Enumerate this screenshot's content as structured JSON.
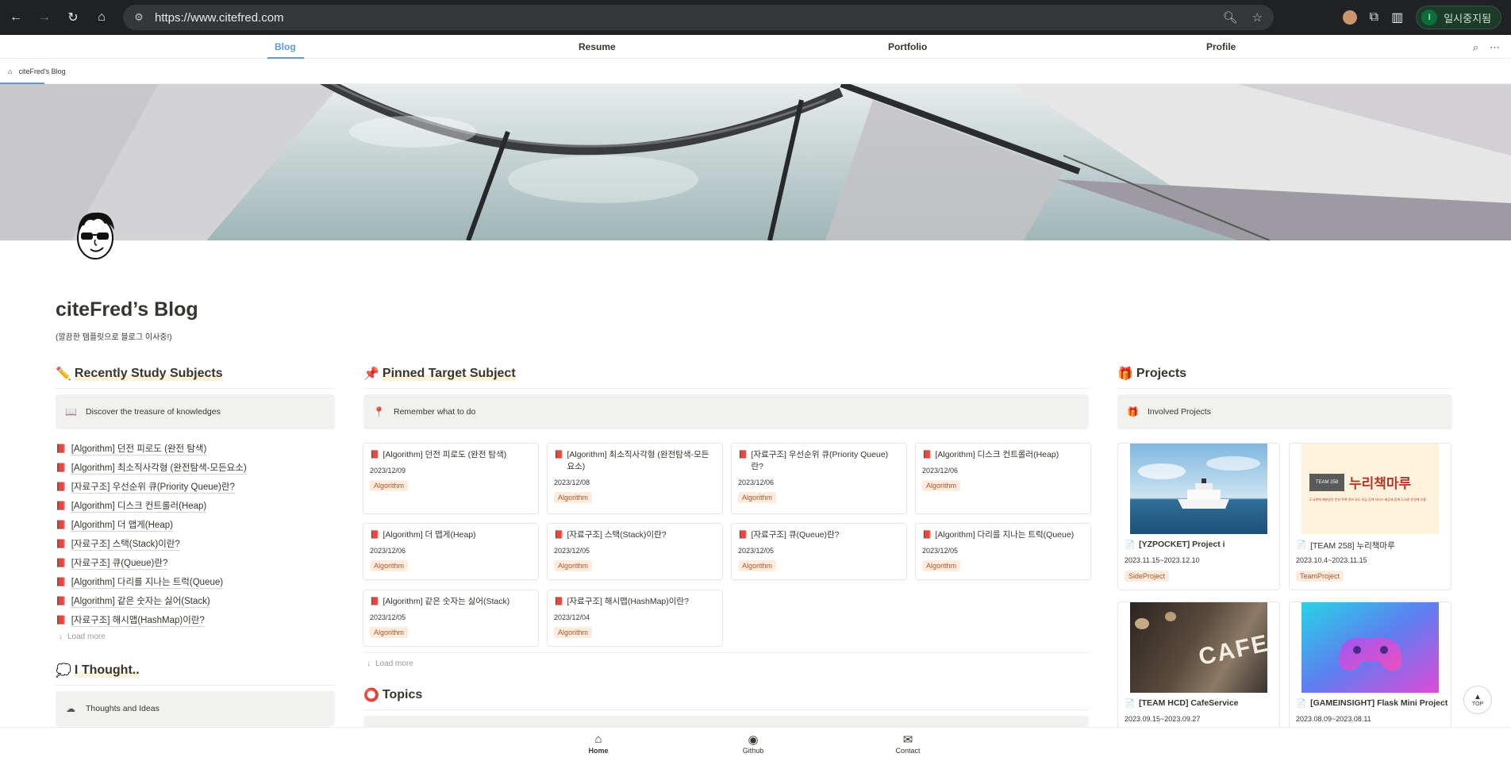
{
  "browser": {
    "url": "https://www.citefred.com",
    "profile_label": "일시중지됨",
    "profile_initial": "I"
  },
  "site_nav": {
    "items": [
      "Blog",
      "Resume",
      "Portfolio",
      "Profile"
    ],
    "active": "Blog"
  },
  "breadcrumb": "citeFred's Blog",
  "page": {
    "title": "citeFred’s Blog",
    "subtitle": "(깔끔한 템플릿으로 블로그 이사중!)"
  },
  "recent": {
    "heading": "Recently Study Subjects",
    "callout": "Discover the treasure of knowledges",
    "items": [
      "[Algorithm] 던전 피로도 (완전 탐색)",
      "[Algorithm] 최소직사각형 (완전탐색-모든요소)",
      "[자료구조] 우선순위 큐(Priority Queue)란?",
      "[Algorithm] 디스크 컨트롤러(Heap)",
      "[Algorithm] 더 맵게(Heap)",
      "[자료구조] 스택(Stack)이란?",
      "[자료구조] 큐(Queue)란?",
      "[Algorithm] 다리를 지나는 트럭(Queue)",
      "[Algorithm] 같은 숫자는 싫어(Stack)",
      "[자료구조] 해시맵(HashMap)이란?"
    ],
    "load_more": "Load more"
  },
  "thought": {
    "heading": "I Thought..",
    "callout": "Thoughts and Ideas"
  },
  "pinned": {
    "heading": "Pinned Target Subject",
    "callout": "Remember what to do",
    "cards": [
      {
        "title": "[Algorithm] 던전 피로도 (완전 탐색)",
        "date": "2023/12/09",
        "tag": "Algorithm"
      },
      {
        "title": "[Algorithm] 최소직사각형 (완전탐색-모든요소)",
        "date": "2023/12/08",
        "tag": "Algorithm"
      },
      {
        "title": "[자료구조] 우선순위 큐(Priority Queue)란?",
        "date": "2023/12/06",
        "tag": "Algorithm"
      },
      {
        "title": "[Algorithm] 디스크 컨트롤러(Heap)",
        "date": "2023/12/06",
        "tag": "Algorithm"
      },
      {
        "title": "[Algorithm] 더 맵게(Heap)",
        "date": "2023/12/06",
        "tag": "Algorithm"
      },
      {
        "title": "[자료구조] 스택(Stack)이란?",
        "date": "2023/12/05",
        "tag": "Algorithm"
      },
      {
        "title": "[자료구조] 큐(Queue)란?",
        "date": "2023/12/05",
        "tag": "Algorithm"
      },
      {
        "title": "[Algorithm] 다리를 지나는 트럭(Queue)",
        "date": "2023/12/05",
        "tag": "Algorithm"
      },
      {
        "title": "[Algorithm] 같은 숫자는 싫어(Stack)",
        "date": "2023/12/05",
        "tag": "Algorithm"
      },
      {
        "title": "[자료구조] 해시맵(HashMap)이란?",
        "date": "2023/12/04",
        "tag": "Algorithm"
      }
    ],
    "load_more": "Load more"
  },
  "topics": {
    "heading": "Topics"
  },
  "projects": {
    "heading": "Projects",
    "callout": "Involved Projects",
    "cards": [
      {
        "title": "[YZPOCKET] Project i",
        "date": "2023.11.15~2023.12.10",
        "tag": "SideProject"
      },
      {
        "title": "[TEAM 258] 누리책마루",
        "date": "2023.10.4~2023.11.15",
        "tag": "TeamProject"
      },
      {
        "title": "[TEAM HCD] CafeService",
        "date": "2023.09.15~2023.09.27",
        "tag": ""
      },
      {
        "title": "[GAMEINSIGHT] Flask Mini Project",
        "date": "2023.08.09~2023.08.11",
        "tag": ""
      }
    ],
    "image_texts": {
      "nuri_badge": "TEAM 258",
      "nuri_title": "누리책마루",
      "nuri_tagline": "도서관에 배분받은 문헌 목록 정보 유도 지능 검색 서비스 제공과 함께 도서관 운영에 유용",
      "cafe_sign": "CAFE"
    }
  },
  "bottom_nav": [
    {
      "label": "Home",
      "icon": "home-icon"
    },
    {
      "label": "Github",
      "icon": "github-icon"
    },
    {
      "label": "Contact",
      "icon": "mail-icon"
    }
  ],
  "top_button": "TOP",
  "colors": {
    "accent": "#5b9bd5",
    "tag_bg": "#fbecdd",
    "tag_text": "#a8552f",
    "callout_bg": "#f1f1ef"
  }
}
